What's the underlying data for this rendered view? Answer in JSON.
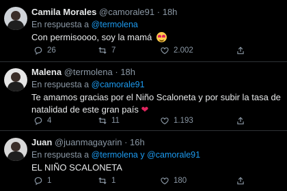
{
  "tweets": [
    {
      "name": "Camila Morales",
      "handle": "@camorale91",
      "dot": "·",
      "time": "18h",
      "reply_prefix": "En respuesta a",
      "reply_to": "@termolena",
      "reply_joiner": "",
      "reply_to_2": "",
      "text": "Con permisoooo, soy la mamá",
      "emoji": "smiling-face-with-heart-eyes",
      "replies": "26",
      "retweets": "7",
      "likes": "2.002"
    },
    {
      "name": "Malena",
      "handle": "@termolena",
      "dot": "·",
      "time": "18h",
      "reply_prefix": "En respuesta a",
      "reply_to": "@camorale91",
      "reply_joiner": "",
      "reply_to_2": "",
      "text": "Te amamos gracias por el Niño Scaloneta y por subir la tasa de natalidad de este gran país",
      "emoji": "red-heart",
      "replies": "4",
      "retweets": "11",
      "likes": "1.193"
    },
    {
      "name": "Juan",
      "handle": "@juanmagayarin",
      "dot": "·",
      "time": "16h",
      "reply_prefix": "En respuesta a",
      "reply_to": "@termolena",
      "reply_joiner": "y",
      "reply_to_2": "@camorale91",
      "text": "EL NIÑO SCALONETA",
      "emoji": "",
      "replies": "1",
      "retweets": "1",
      "likes": "180"
    }
  ],
  "colors": {
    "background": "#000000",
    "text": "#e7e9ea",
    "muted": "#8b98a5",
    "link": "#1d9bf0",
    "divider": "#2f3336",
    "heart": "#e0245e"
  },
  "icons": [
    "reply-icon",
    "retweet-icon",
    "like-icon",
    "share-icon"
  ]
}
